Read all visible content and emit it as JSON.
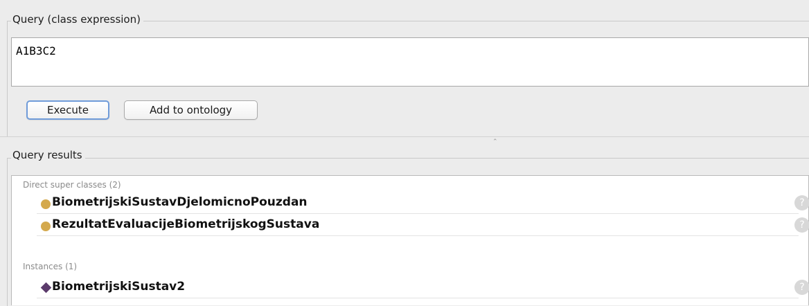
{
  "query": {
    "legend": "Query (class expression)",
    "expression": "A1B3C2",
    "execute_label": "Execute",
    "add_label": "Add to ontology"
  },
  "results": {
    "legend": "Query results",
    "sections": [
      {
        "label": "Direct super classes (2)",
        "items": [
          {
            "name": "BiometrijskiSustavDjelomicnoPouzdan",
            "icon": "class-icon",
            "help": "?"
          },
          {
            "name": "RezultatEvaluacijeBiometrijskogSustava",
            "icon": "class-icon",
            "help": "?"
          }
        ]
      },
      {
        "label": "Instances (1)",
        "items": [
          {
            "name": "BiometrijskiSustav2",
            "icon": "individual-icon",
            "help": "?"
          }
        ]
      }
    ]
  },
  "colors": {
    "class_icon": "#d4a94d",
    "individual_icon": "#5b3b6b",
    "execute_focus": "#6f9bd9"
  }
}
